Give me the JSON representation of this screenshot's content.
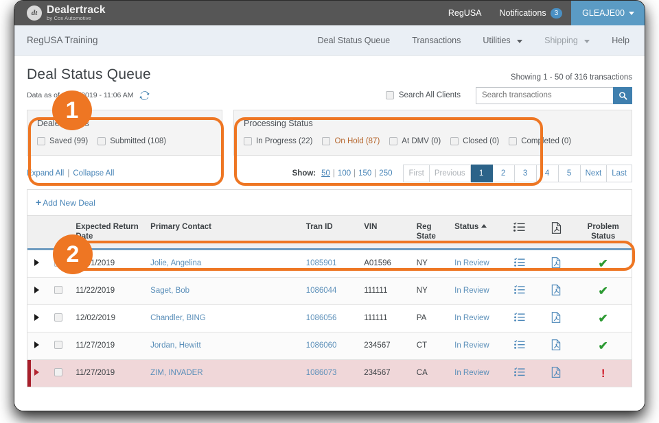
{
  "colors": {
    "accent_orange": "#ee7623",
    "brand_blue": "#4a86b8",
    "active_page_blue": "#2c6389",
    "problem_row_pink": "#f0d7d9",
    "problem_red": "#cf1b28",
    "ok_green": "#2d9a33"
  },
  "topbar": {
    "logo_main": "Dealertrack",
    "logo_sub": "by Cox Automotive",
    "logo_mark": "dt-logo-icon",
    "nav": [
      {
        "label": "RegUSA"
      },
      {
        "label": "Notifications",
        "count": "3"
      }
    ],
    "user": {
      "label": "GLEAJE00",
      "caret": "caret-down-icon"
    }
  },
  "subnav": {
    "brand": "RegUSA Training",
    "links": [
      {
        "label": "Deal Status Queue",
        "muted": false,
        "caret": false
      },
      {
        "label": "Transactions",
        "muted": false,
        "caret": false
      },
      {
        "label": "Utilities",
        "muted": false,
        "caret": true
      },
      {
        "label": "Shipping",
        "muted": true,
        "caret": true
      },
      {
        "label": "Help",
        "muted": false,
        "caret": false
      }
    ]
  },
  "page": {
    "title": "Deal Status Queue",
    "showing": "Showing 1 - 50 of 316 transactions",
    "data_as_of": "Data as of 11/27/2019 - 11:06 AM",
    "refresh_icon": "refresh-icon",
    "search_all_clients_label": "Search All Clients",
    "search_placeholder": "Search transactions",
    "search_value": "",
    "search_icon": "search-icon"
  },
  "filters": {
    "dealer": {
      "title": "Dealer Status",
      "options": [
        {
          "label": "Saved (99)",
          "checked": false
        },
        {
          "label": "Submitted (108)",
          "checked": false
        }
      ]
    },
    "processing": {
      "title": "Processing Status",
      "options": [
        {
          "label": "In Progress (22)",
          "checked": false,
          "highlight": false
        },
        {
          "label": "On Hold (87)",
          "checked": false,
          "highlight": true
        },
        {
          "label": "At DMV (0)",
          "checked": false,
          "highlight": false
        },
        {
          "label": "Closed (0)",
          "checked": false,
          "highlight": false
        },
        {
          "label": "Completed (0)",
          "checked": false,
          "highlight": false
        }
      ]
    }
  },
  "callouts": [
    {
      "number": "1"
    },
    {
      "number": "2"
    }
  ],
  "toolrow": {
    "expand_all": "Expand All",
    "separator": "|",
    "collapse_all": "Collapse All",
    "show_label": "Show:",
    "show_options": [
      {
        "label": "50",
        "active": true
      },
      {
        "label": "100",
        "active": false
      },
      {
        "label": "150",
        "active": false
      },
      {
        "label": "250",
        "active": false
      }
    ],
    "pages": [
      {
        "label": "First",
        "state": "dim"
      },
      {
        "label": "Previous",
        "state": "dim"
      },
      {
        "label": "1",
        "state": "active"
      },
      {
        "label": "2",
        "state": "normal"
      },
      {
        "label": "3",
        "state": "normal"
      },
      {
        "label": "4",
        "state": "normal"
      },
      {
        "label": "5",
        "state": "normal"
      },
      {
        "label": "Next",
        "state": "normal"
      },
      {
        "label": "Last",
        "state": "normal"
      }
    ]
  },
  "table": {
    "add_new_deal": "Add New Deal",
    "columns": [
      {
        "label": "Expected Return Date",
        "sort": null
      },
      {
        "label": "Primary Contact",
        "sort": null
      },
      {
        "label": "Tran ID",
        "sort": null
      },
      {
        "label": "VIN",
        "sort": null
      },
      {
        "label": "Reg State",
        "sort": null
      },
      {
        "label": "Status",
        "sort": "asc"
      },
      {
        "label": "",
        "icon": "checklist-icon"
      },
      {
        "label": "",
        "icon": "pdf-file-icon"
      },
      {
        "label": "Problem Status",
        "sort": null
      }
    ],
    "rows": [
      {
        "expand": "expand-triangle-icon",
        "selected": false,
        "return_date": "11/21/2019",
        "primary_contact": "Jolie, Angelina",
        "tran_id": "1085901",
        "vin": "A01596",
        "reg_state": "NY",
        "status": "In Review",
        "notes_icon": "checklist-icon",
        "pdf_icon": "pdf-file-icon",
        "problem_status": "check",
        "problem": false
      },
      {
        "expand": "expand-triangle-icon",
        "selected": false,
        "return_date": "11/22/2019",
        "primary_contact": "Saget, Bob",
        "tran_id": "1086044",
        "vin": "111111",
        "reg_state": "NY",
        "status": "In Review",
        "notes_icon": "checklist-icon",
        "pdf_icon": "pdf-file-icon",
        "problem_status": "check",
        "problem": false
      },
      {
        "expand": "expand-triangle-icon",
        "selected": false,
        "return_date": "12/02/2019",
        "primary_contact": "Chandler, BING",
        "tran_id": "1086056",
        "vin": "111111",
        "reg_state": "PA",
        "status": "In Review",
        "notes_icon": "checklist-icon",
        "pdf_icon": "pdf-file-icon",
        "problem_status": "check",
        "problem": false
      },
      {
        "expand": "expand-triangle-icon",
        "selected": false,
        "return_date": "11/27/2019",
        "primary_contact": "Jordan, Hewitt",
        "tran_id": "1086060",
        "vin": "234567",
        "reg_state": "CT",
        "status": "In Review",
        "notes_icon": "checklist-icon",
        "pdf_icon": "pdf-file-icon",
        "problem_status": "check",
        "problem": false
      },
      {
        "expand": "expand-triangle-icon",
        "selected": false,
        "return_date": "11/27/2019",
        "primary_contact": "ZIM, INVADER",
        "tran_id": "1086073",
        "vin": "234567",
        "reg_state": "CA",
        "status": "In Review",
        "notes_icon": "checklist-icon",
        "pdf_icon": "pdf-file-icon",
        "problem_status": "alert",
        "problem": true
      }
    ]
  }
}
